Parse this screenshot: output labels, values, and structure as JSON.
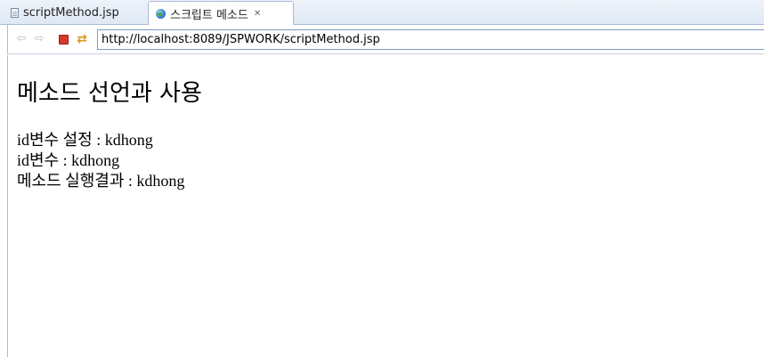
{
  "tabs": [
    {
      "label": "scriptMethod.jsp",
      "icon": "file-icon",
      "active": false
    },
    {
      "label": "스크립트 메소드",
      "icon": "globe-icon",
      "active": true,
      "close": "✕"
    }
  ],
  "toolbar": {
    "back_icon": "⇦",
    "forward_icon": "⇨",
    "refresh_icon": "⇄",
    "url": "http://localhost:8089/JSPWORK/scriptMethod.jsp"
  },
  "page": {
    "heading": "메소드 선언과 사용",
    "lines": [
      "id변수 설정 : kdhong",
      "id변수 : kdhong",
      "메소드 실행결과 : kdhong"
    ]
  },
  "colors": {
    "tabbar": "#dfe8f4",
    "border": "#a9bcd6",
    "stop_red": "#d63a2f"
  }
}
